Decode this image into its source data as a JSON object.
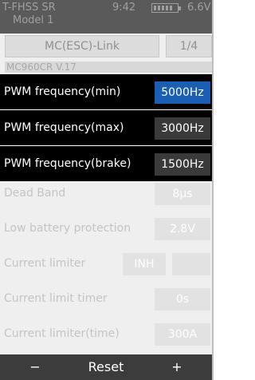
{
  "header": {
    "system": "T-FHSS SR",
    "time": "9:42",
    "voltage": "6.6V",
    "model": "Model 1"
  },
  "link_button": "MC(ESC)-Link",
  "page_indicator": "1/4",
  "esc_version": "MC960CR V.17",
  "rows": [
    {
      "label": "PWM frequency(min)",
      "value": "5000Hz"
    },
    {
      "label": "PWM frequency(max)",
      "value": "3000Hz"
    },
    {
      "label": "PWM frequency(brake)",
      "value": "1500Hz"
    },
    {
      "label": "Dead Band",
      "value": "8μs"
    },
    {
      "label": "Low battery protection",
      "value": "2.8V"
    },
    {
      "label": "Current limiter",
      "value": "INH",
      "value2": ""
    },
    {
      "label": "Current limit timer",
      "value": "0s"
    },
    {
      "label": "Current limiter(time)",
      "value": "300A"
    }
  ],
  "footer": {
    "minus": "−",
    "reset": "Reset",
    "plus": "+"
  },
  "colors": {
    "selected": "#1a5fb4",
    "header_bg": "#5a5a5a",
    "row_dark_bg": "#000000"
  }
}
